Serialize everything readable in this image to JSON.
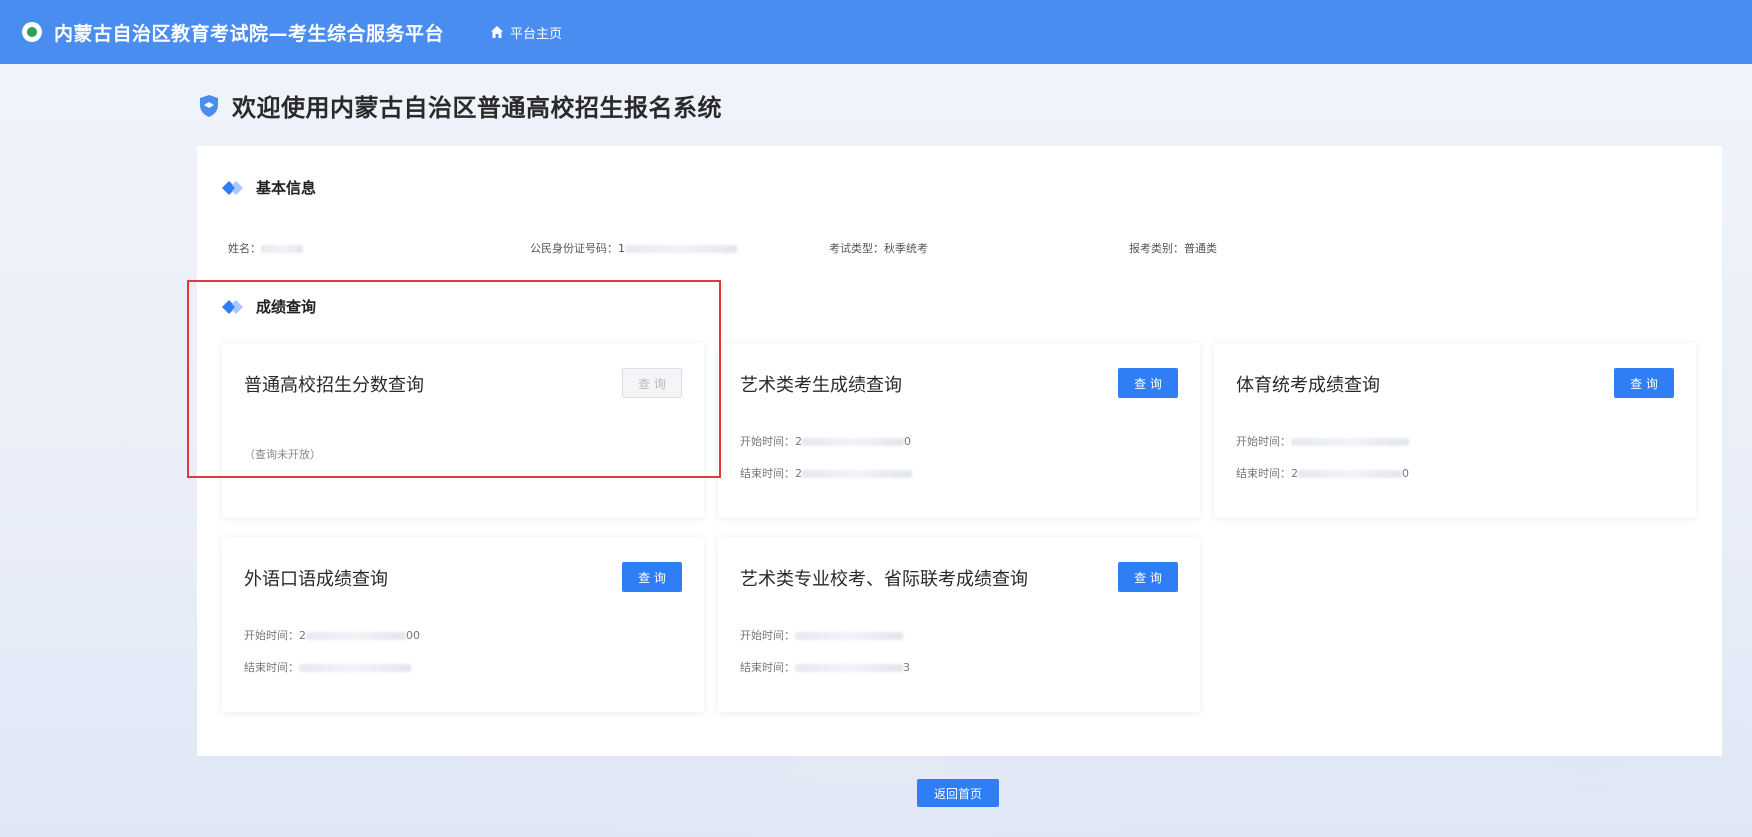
{
  "header": {
    "site_title": "内蒙古自治区教育考试院—考生综合服务平台",
    "home_label": "平台主页"
  },
  "page": {
    "heading": "欢迎使用内蒙古自治区普通高校招生报名系统"
  },
  "basic_info": {
    "section_title": "基本信息",
    "name_label": "姓名：",
    "id_label": "公民身份证号码：",
    "id_prefix": "1",
    "exam_type_label": "考试类型：",
    "exam_type_value": "秋季统考",
    "category_label": "报考类别：",
    "category_value": "普通类"
  },
  "score_query": {
    "section_title": "成绩查询",
    "cards": [
      {
        "title": "普通高校招生分数查询",
        "button": "查 询",
        "note": "（查询未开放）"
      },
      {
        "title": "艺术类考生成绩查询",
        "button": "查 询",
        "start_label": "开始时间：",
        "start_prefix": "2",
        "start_suffix": "0",
        "end_label": "结束时间：",
        "end_prefix": "2",
        "end_suffix": ""
      },
      {
        "title": "体育统考成绩查询",
        "button": "查 询",
        "start_label": "开始时间：",
        "start_prefix": "",
        "start_suffix": "",
        "end_label": "结束时间：",
        "end_prefix": "2",
        "end_suffix": "0"
      },
      {
        "title": "外语口语成绩查询",
        "button": "查 询",
        "start_label": "开始时间：",
        "start_prefix": "2",
        "start_suffix": "00",
        "end_label": "结束时间：",
        "end_prefix": "",
        "end_suffix": ""
      },
      {
        "title": "艺术类专业校考、省际联考成绩查询",
        "button": "查 询",
        "start_label": "开始时间：",
        "start_prefix": "",
        "start_suffix": "",
        "end_label": "结束时间：",
        "end_prefix": "",
        "end_suffix": "3"
      }
    ]
  },
  "footer": {
    "back_button": "返回首页"
  },
  "colors": {
    "header_blue": "#4a8df0",
    "button_blue": "#2f7ef5",
    "highlight_red": "#e23a3a"
  }
}
